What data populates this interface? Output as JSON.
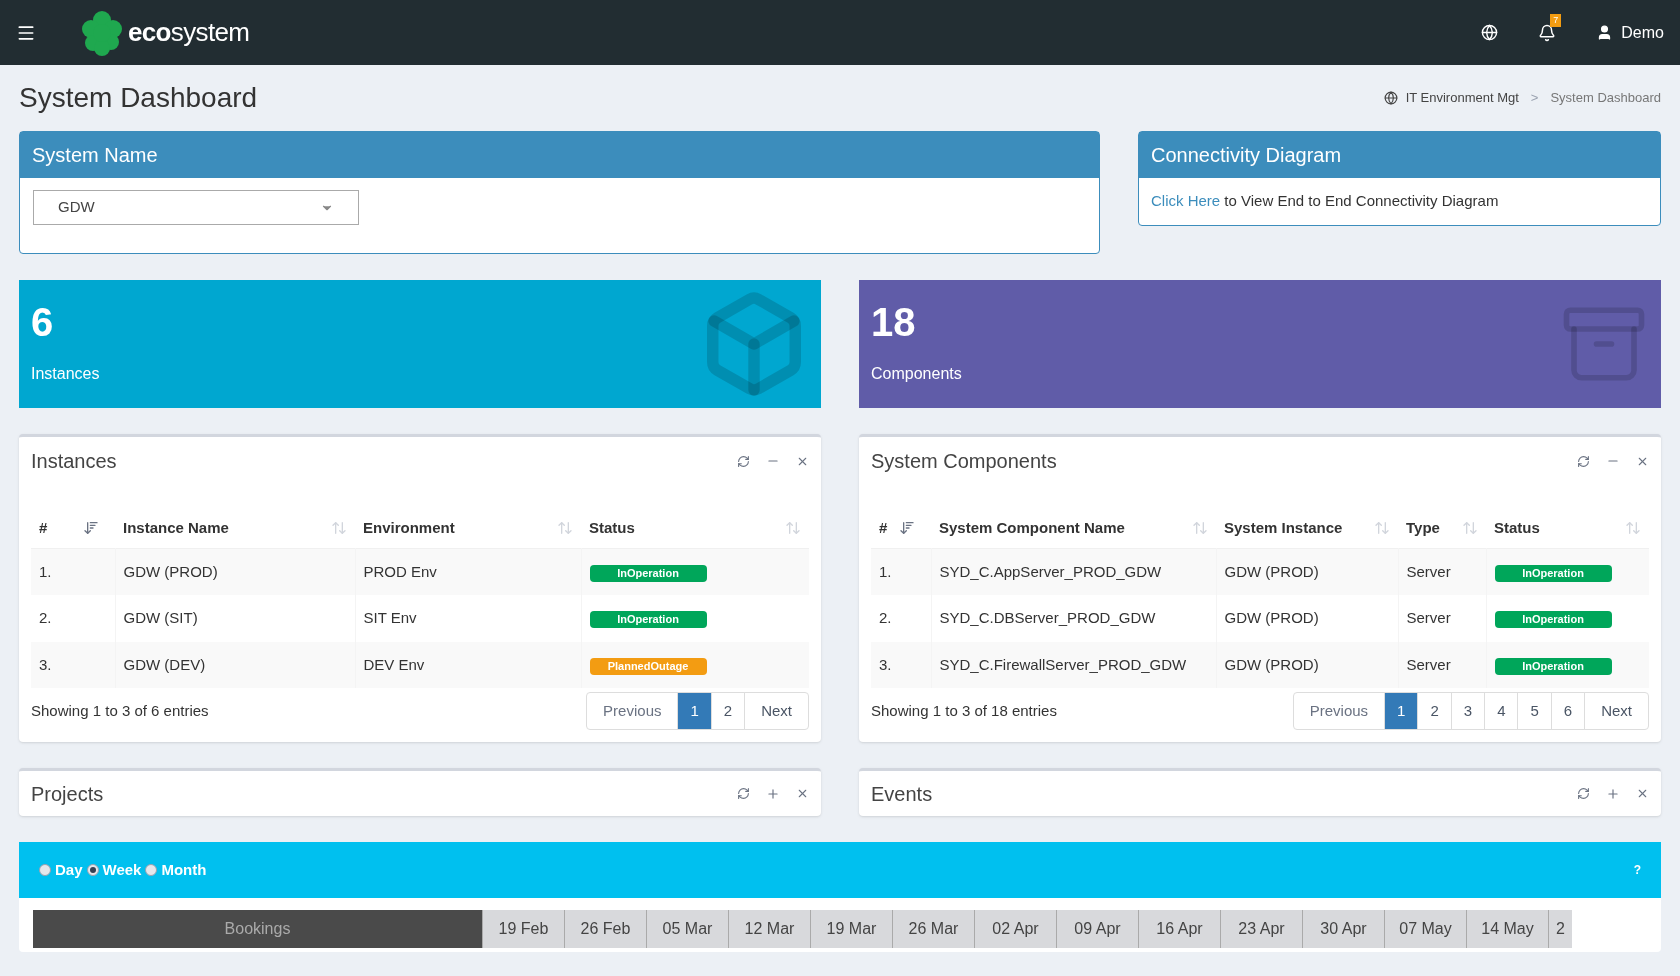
{
  "topbar": {
    "logo_bold": "eco",
    "logo_rest": "system",
    "notification_count": "7",
    "user": "Demo"
  },
  "page": {
    "title": "System Dashboard",
    "breadcrumb_separator": ">",
    "breadcrumb": [
      {
        "label": "IT Environment Mgt",
        "selected": false
      },
      {
        "label": "System Dashboard",
        "selected": true
      }
    ]
  },
  "system_name": {
    "title": "System Name",
    "value": "GDW"
  },
  "connectivity": {
    "title": "Connectivity Diagram",
    "link": "Click Here",
    "text": "to View End to End Connectivity Diagram"
  },
  "stats": [
    {
      "value": "6",
      "label": "Instances",
      "kind": "instances"
    },
    {
      "value": "18",
      "label": "Components",
      "kind": "components"
    }
  ],
  "instances": {
    "title": "Instances",
    "columns": [
      "#",
      "Instance Name",
      "Environment",
      "Status"
    ],
    "rows": [
      {
        "cells": [
          "1.",
          "GDW (PROD)",
          "PROD Env"
        ],
        "status": "InOperation",
        "color": "#00a65a"
      },
      {
        "cells": [
          "2.",
          "GDW (SIT)",
          "SIT Env"
        ],
        "status": "InOperation",
        "color": "#00a65a"
      },
      {
        "cells": [
          "3.",
          "GDW (DEV)",
          "DEV Env"
        ],
        "status": "PlannedOutage",
        "color": "#f39c12"
      }
    ],
    "info": "Showing 1 to 3 of 6 entries",
    "previous": "Previous",
    "next": "Next",
    "pages": [
      {
        "label": "1",
        "selected": true
      },
      {
        "label": "2",
        "selected": false
      }
    ]
  },
  "components": {
    "title": "System Components",
    "columns": [
      "#",
      "System Component Name",
      "System Instance",
      "Type",
      "Status"
    ],
    "rows": [
      {
        "cells": [
          "1.",
          "SYD_C.AppServer_PROD_GDW",
          "GDW (PROD)",
          "Server"
        ],
        "status": "InOperation",
        "color": "#00a65a"
      },
      {
        "cells": [
          "2.",
          "SYD_C.DBServer_PROD_GDW",
          "GDW (PROD)",
          "Server"
        ],
        "status": "InOperation",
        "color": "#00a65a"
      },
      {
        "cells": [
          "3.",
          "SYD_C.FirewallServer_PROD_GDW",
          "GDW (PROD)",
          "Server"
        ],
        "status": "InOperation",
        "color": "#00a65a"
      }
    ],
    "info": "Showing 1 to 3 of 18 entries",
    "previous": "Previous",
    "next": "Next",
    "pages": [
      {
        "label": "1",
        "selected": true
      },
      {
        "label": "2",
        "selected": false
      },
      {
        "label": "3",
        "selected": false
      },
      {
        "label": "4",
        "selected": false
      },
      {
        "label": "5",
        "selected": false
      },
      {
        "label": "6",
        "selected": false
      }
    ]
  },
  "projects": {
    "title": "Projects"
  },
  "events": {
    "title": "Events"
  },
  "gantt": {
    "scales": [
      {
        "label": "Day",
        "selected": false
      },
      {
        "label": "Week",
        "selected": true
      },
      {
        "label": "Month",
        "selected": false
      }
    ],
    "help": "?",
    "first_column": "Bookings",
    "weeks": [
      "19 Feb",
      "26 Feb",
      "05 Mar",
      "12 Mar",
      "19 Mar",
      "26 Mar",
      "02 Apr",
      "09 Apr",
      "16 Apr",
      "23 Apr",
      "30 Apr",
      "07 May",
      "14 May",
      "2"
    ]
  }
}
